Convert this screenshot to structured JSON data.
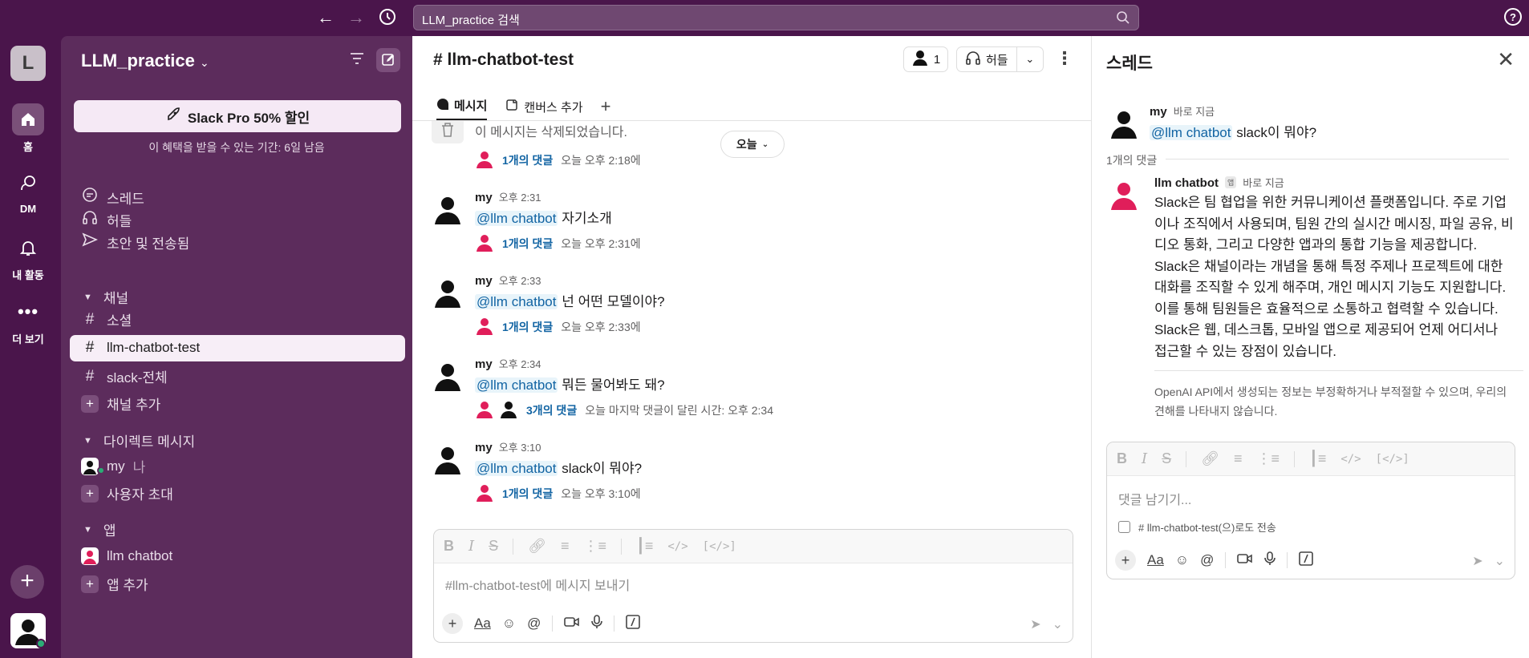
{
  "topbar": {
    "search_text": "LLM_practice 검색"
  },
  "rail": {
    "workspace_initial": "L",
    "items": [
      {
        "label": "홈"
      },
      {
        "label": "DM"
      },
      {
        "label": "내 활동"
      },
      {
        "label": "더 보기"
      }
    ]
  },
  "sidebar": {
    "workspace_name": "LLM_practice",
    "promo_button": "Slack Pro 50% 할인",
    "promo_note": "이 혜택을 받을 수 있는 기간: 6일 남음",
    "nav": [
      {
        "label": "스레드"
      },
      {
        "label": "허들"
      },
      {
        "label": "초안 및 전송됨"
      }
    ],
    "channels_header": "채널",
    "channels": [
      {
        "label": "소셜"
      },
      {
        "label": "llm-chatbot-test"
      },
      {
        "label": "slack-전체"
      }
    ],
    "add_channel": "채널 추가",
    "dm_header": "다이렉트 메시지",
    "dm_me_name": "my",
    "dm_me_suffix": "나",
    "invite_user": "사용자 초대",
    "apps_header": "앱",
    "app_name": "llm chatbot",
    "add_app": "앱 추가"
  },
  "main": {
    "channel_title": "# llm-chatbot-test",
    "member_count": "1",
    "huddle_label": "허들",
    "tabs": [
      {
        "label": "메시지"
      },
      {
        "label": "캔버스 추가"
      }
    ],
    "today_pill": "오늘",
    "deleted_text": "이 메시지는 삭제되었습니다.",
    "deleted_replies": {
      "count": "1개의 댓글",
      "time": "오늘 오후 2:18에"
    },
    "messages": [
      {
        "user": "my",
        "time": "오후 2:31",
        "mention": "@llm chatbot",
        "text": "자기소개",
        "reply_count": "1개의 댓글",
        "reply_time": "오늘 오후 2:31에"
      },
      {
        "user": "my",
        "time": "오후 2:33",
        "mention": "@llm chatbot",
        "text": "넌 어떤 모델이야?",
        "reply_count": "1개의 댓글",
        "reply_time": "오늘 오후 2:33에"
      },
      {
        "user": "my",
        "time": "오후 2:34",
        "mention": "@llm chatbot",
        "text": "뭐든 물어봐도 돼?",
        "reply_count": "3개의 댓글",
        "reply_time": "오늘 마지막 댓글이 달린 시간: 오후 2:34"
      },
      {
        "user": "my",
        "time": "오후 3:10",
        "mention": "@llm chatbot",
        "text": "slack이 뭐야?",
        "reply_count": "1개의 댓글",
        "reply_time": "오늘 오후 3:10에"
      }
    ],
    "composer_placeholder": "#llm-chatbot-test에 메시지 보내기"
  },
  "thread": {
    "title": "스레드",
    "parent": {
      "user": "my",
      "time": "바로 지금",
      "mention": "@llm chatbot",
      "text": "slack이 뭐야?"
    },
    "reply_count": "1개의 댓글",
    "reply": {
      "user": "llm chatbot",
      "badge": "앱",
      "time": "바로 지금",
      "text": "Slack은 팀 협업을 위한 커뮤니케이션 플랫폼입니다. 주로 기업이나 조직에서 사용되며, 팀원 간의 실시간 메시징, 파일 공유, 비디오 통화, 그리고 다양한 앱과의 통합 기능을 제공합니다. Slack은 채널이라는 개념을 통해 특정 주제나 프로젝트에 대한 대화를 조직할 수 있게 해주며, 개인 메시지 기능도 지원합니다. 이를 통해 팀원들은 효율적으로 소통하고 협력할 수 있습니다. Slack은 웹, 데스크톱, 모바일 앱으로 제공되어 언제 어디서나 접근할 수 있는 장점이 있습니다."
    },
    "disclaimer": "OpenAI API에서 생성되는 정보는 부정확하거나 부적절할 수 있으며, 우리의 견해를 나타내지 않습니다.",
    "composer_placeholder": "댓글 남기기...",
    "also_send": "# llm-chatbot-test(으)로도 전송"
  },
  "colors": {
    "aubergine": "#4a154b",
    "sidebar": "#5c2c5c",
    "link": "#1264a3",
    "bot_pink": "#e01e5a"
  }
}
